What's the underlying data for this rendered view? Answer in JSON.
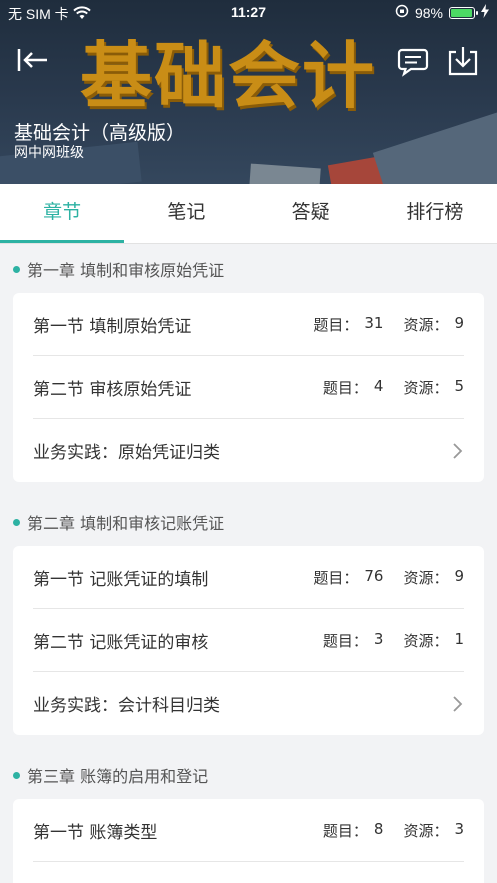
{
  "status_bar": {
    "carrier": "无 SIM 卡",
    "time": "11:27",
    "battery": "98%",
    "battery_level": 0.98
  },
  "header": {
    "banner_text": "基础会计",
    "title": "基础会计（高级版）",
    "subtitle": "网中网班级"
  },
  "tabs": [
    {
      "label": "章节",
      "active": true
    },
    {
      "label": "笔记",
      "active": false
    },
    {
      "label": "答疑",
      "active": false
    },
    {
      "label": "排行榜",
      "active": false
    }
  ],
  "chapters": [
    {
      "title": "第一章 填制和审核原始凭证",
      "items": [
        {
          "name": "第一节 填制原始凭证",
          "q_label": "题目：",
          "q": "31",
          "r_label": "资源：",
          "r": "9"
        },
        {
          "name": "第二节 审核原始凭证",
          "q_label": "题目：",
          "q": "4",
          "r_label": "资源：",
          "r": "5"
        },
        {
          "name": "业务实践：原始凭证归类"
        }
      ]
    },
    {
      "title": "第二章 填制和审核记账凭证",
      "items": [
        {
          "name": "第一节 记账凭证的填制",
          "q_label": "题目：",
          "q": "76",
          "r_label": "资源：",
          "r": "9"
        },
        {
          "name": "第二节 记账凭证的审核",
          "q_label": "题目：",
          "q": "3",
          "r_label": "资源：",
          "r": "1"
        },
        {
          "name": "业务实践：会计科目归类"
        }
      ]
    },
    {
      "title": "第三章 账簿的启用和登记",
      "items": [
        {
          "name": "第一节 账簿类型",
          "q_label": "题目：",
          "q": "8",
          "r_label": "资源：",
          "r": "3"
        }
      ]
    }
  ],
  "colors": {
    "accent": "#2db2a3",
    "banner_text": "#c98d16",
    "header_bg": "#2a3a4e"
  }
}
